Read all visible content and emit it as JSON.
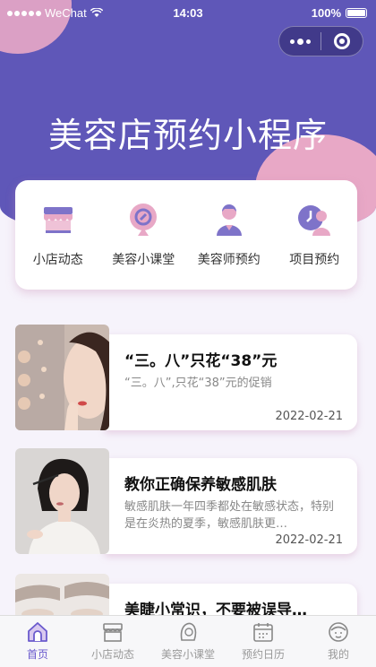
{
  "status_bar": {
    "carrier": "WeChat",
    "time": "14:03",
    "battery": "100%"
  },
  "page_title": "美容店预约小程序",
  "menu": [
    {
      "label": "小店动态",
      "icon": "shop-icon"
    },
    {
      "label": "美容小课堂",
      "icon": "class-icon"
    },
    {
      "label": "美容师预约",
      "icon": "beautician-icon"
    },
    {
      "label": "项目预约",
      "icon": "appointment-icon"
    }
  ],
  "articles": [
    {
      "title": "“三。八”只花“38”元",
      "desc": "“三。八”,只花“38”元的促销",
      "date": "2022-02-21"
    },
    {
      "title": "教你正确保养敏感肌肤",
      "desc": "敏感肌肤一年四季都处在敏感状态，特别是在炎热的夏季，敏感肌肤更…",
      "date": "2022-02-21"
    },
    {
      "title": "美睫小常识，不要被误导…",
      "desc": "",
      "date": ""
    }
  ],
  "tabbar": [
    {
      "label": "首页",
      "icon": "home-icon",
      "active": true
    },
    {
      "label": "小店动态",
      "icon": "shop-tab-icon",
      "active": false
    },
    {
      "label": "美容小课堂",
      "icon": "class-tab-icon",
      "active": false
    },
    {
      "label": "预约日历",
      "icon": "calendar-icon",
      "active": false
    },
    {
      "label": "我的",
      "icon": "profile-icon",
      "active": false
    }
  ],
  "colors": {
    "primary": "#5f57b8",
    "accent_pink": "#e8a8c6",
    "tab_active": "#6a5acd"
  }
}
